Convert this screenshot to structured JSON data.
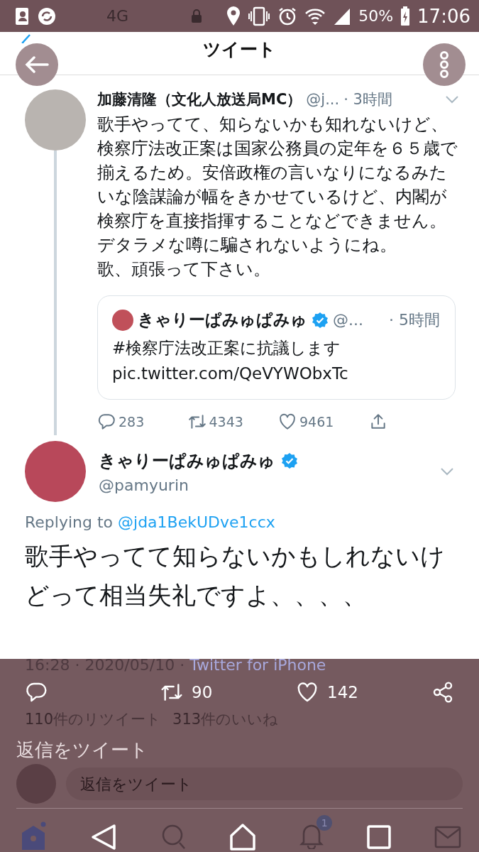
{
  "status_bar": {
    "network": "4G",
    "battery": "50%",
    "time": "17:06"
  },
  "header": {
    "title": "ツイート"
  },
  "parent_tweet": {
    "name": "加藤清隆（文化人放送局MC）",
    "handle": "@j...",
    "time": "· 3時間",
    "text": "歌手やってて、知らないかも知れないけど、検察庁法改正案は国家公務員の定年を６５歳で揃えるため。安倍政権の言いなりになるみたいな陰謀論が幅をきかせているけど、内閣が検察庁を直接指揮することなどできません。デタラメな噂に騙されないようにね。",
    "text_line_2": "歌、頑張って下さい。",
    "quoted": {
      "name": "きゃりーぱみゅぱみゅ",
      "verified": true,
      "handle": "@...",
      "time": "· 5時間",
      "text": "#検察庁法改正案に抗議します",
      "link": "pic.twitter.com/QeVYWObxTc"
    },
    "actions": [
      {
        "kind": "reply",
        "count": "283"
      },
      {
        "kind": "retweet",
        "count": "4343"
      },
      {
        "kind": "like",
        "count": "9461"
      },
      {
        "kind": "share"
      }
    ]
  },
  "main_tweet": {
    "name": "きゃりーぱみゅぱみゅ",
    "verified": true,
    "handle": "@pamyurin",
    "replying_label": "Replying to",
    "replying_to": "@jda1BekUDve1ccx",
    "text": "歌手やってて知らないかもしれないけどって相当失礼ですよ、、、、",
    "timestamp": "16:28 · 2020/05/10 ·",
    "source": "Twitter for iPhone",
    "actions": [
      {
        "kind": "reply"
      },
      {
        "kind": "retweet",
        "count": "90"
      },
      {
        "kind": "like",
        "count": "142"
      },
      {
        "kind": "share"
      }
    ],
    "stats": [
      {
        "count": "110",
        "label": "件のリツイート"
      },
      {
        "count": "313",
        "label": "件のいいね"
      }
    ]
  },
  "reply_bar": {
    "label": "返信をツイート",
    "placeholder": "返信をツイート"
  },
  "nav": {
    "notification_badge": "1"
  }
}
